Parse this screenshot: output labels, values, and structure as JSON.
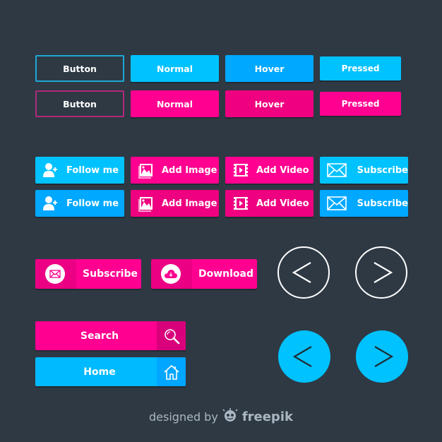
{
  "colors": {
    "background": "#2e3944",
    "cyan": "#00c2ff",
    "blue": "#00a8ff",
    "pink": "#ff0090",
    "outline_blue": "#1ea7d8",
    "outline_pink": "#b02a78"
  },
  "state_buttons": {
    "blue_row": [
      "Button",
      "Normal",
      "Hover",
      "Pressed"
    ],
    "pink_row": [
      "Button",
      "Normal",
      "Hover",
      "Pressed"
    ]
  },
  "social_buttons": {
    "row1": [
      {
        "label": "Follow me",
        "icon": "add-user-icon"
      },
      {
        "label": "Add Image",
        "icon": "image-icon"
      },
      {
        "label": "Add Video",
        "icon": "video-icon"
      },
      {
        "label": "Subscribe",
        "icon": "envelope-icon"
      }
    ],
    "row2": [
      {
        "label": "Follow me",
        "icon": "add-user-icon"
      },
      {
        "label": "Add Image",
        "icon": "image-icon"
      },
      {
        "label": "Add Video",
        "icon": "video-icon"
      },
      {
        "label": "Subscribe",
        "icon": "envelope-icon"
      }
    ]
  },
  "pill_buttons": [
    {
      "label": "Subscribe",
      "icon": "envelope-icon"
    },
    {
      "label": "Download",
      "icon": "cloud-download-icon"
    }
  ],
  "bar_buttons": [
    {
      "label": "Search",
      "icon": "search-icon"
    },
    {
      "label": "Home",
      "icon": "home-icon"
    }
  ],
  "nav_arrows": {
    "outline": [
      "previous",
      "next"
    ],
    "filled": [
      "previous",
      "next"
    ]
  },
  "footer": {
    "text": "designed by",
    "brand": "freepik"
  }
}
